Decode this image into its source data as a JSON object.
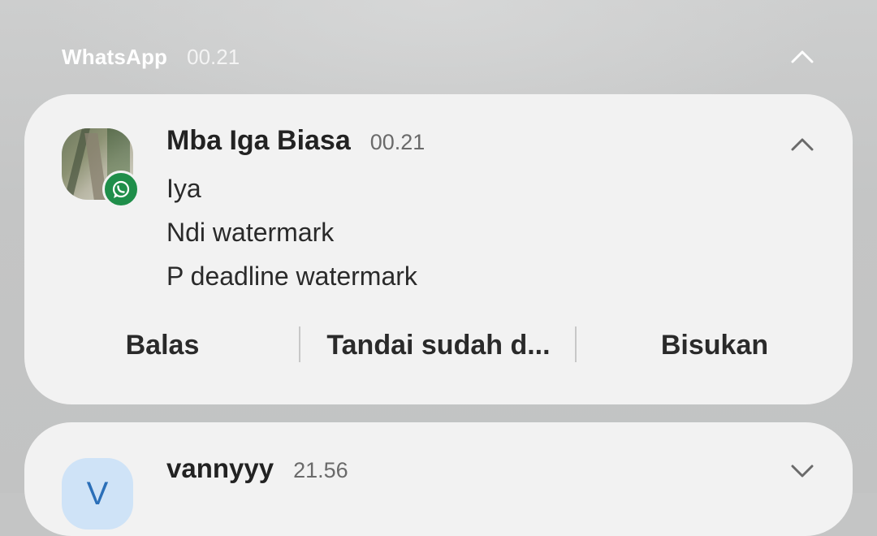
{
  "group": {
    "app_name": "WhatsApp",
    "time": "00.21",
    "chevron_icon": "chevron-up-icon"
  },
  "notifications": [
    {
      "sender": "Mba Iga Biasa",
      "time": "00.21",
      "badge_icon": "whatsapp-icon",
      "chevron_icon": "chevron-up-icon",
      "messages": [
        "Iya",
        "Ndi watermark",
        "P deadline watermark"
      ],
      "actions": [
        "Balas",
        "Tandai sudah d...",
        "Bisukan"
      ]
    },
    {
      "sender": "vannyyy",
      "time": "21.56",
      "avatar_letter": "V",
      "chevron_icon": "chevron-down-icon"
    }
  ],
  "colors": {
    "background": "#c4c5c5",
    "card": "#f2f2f2",
    "whatsapp_green": "#1f8e4a",
    "avatar_v_bg": "#cfe3f7",
    "avatar_v_text": "#2b6fb8"
  }
}
